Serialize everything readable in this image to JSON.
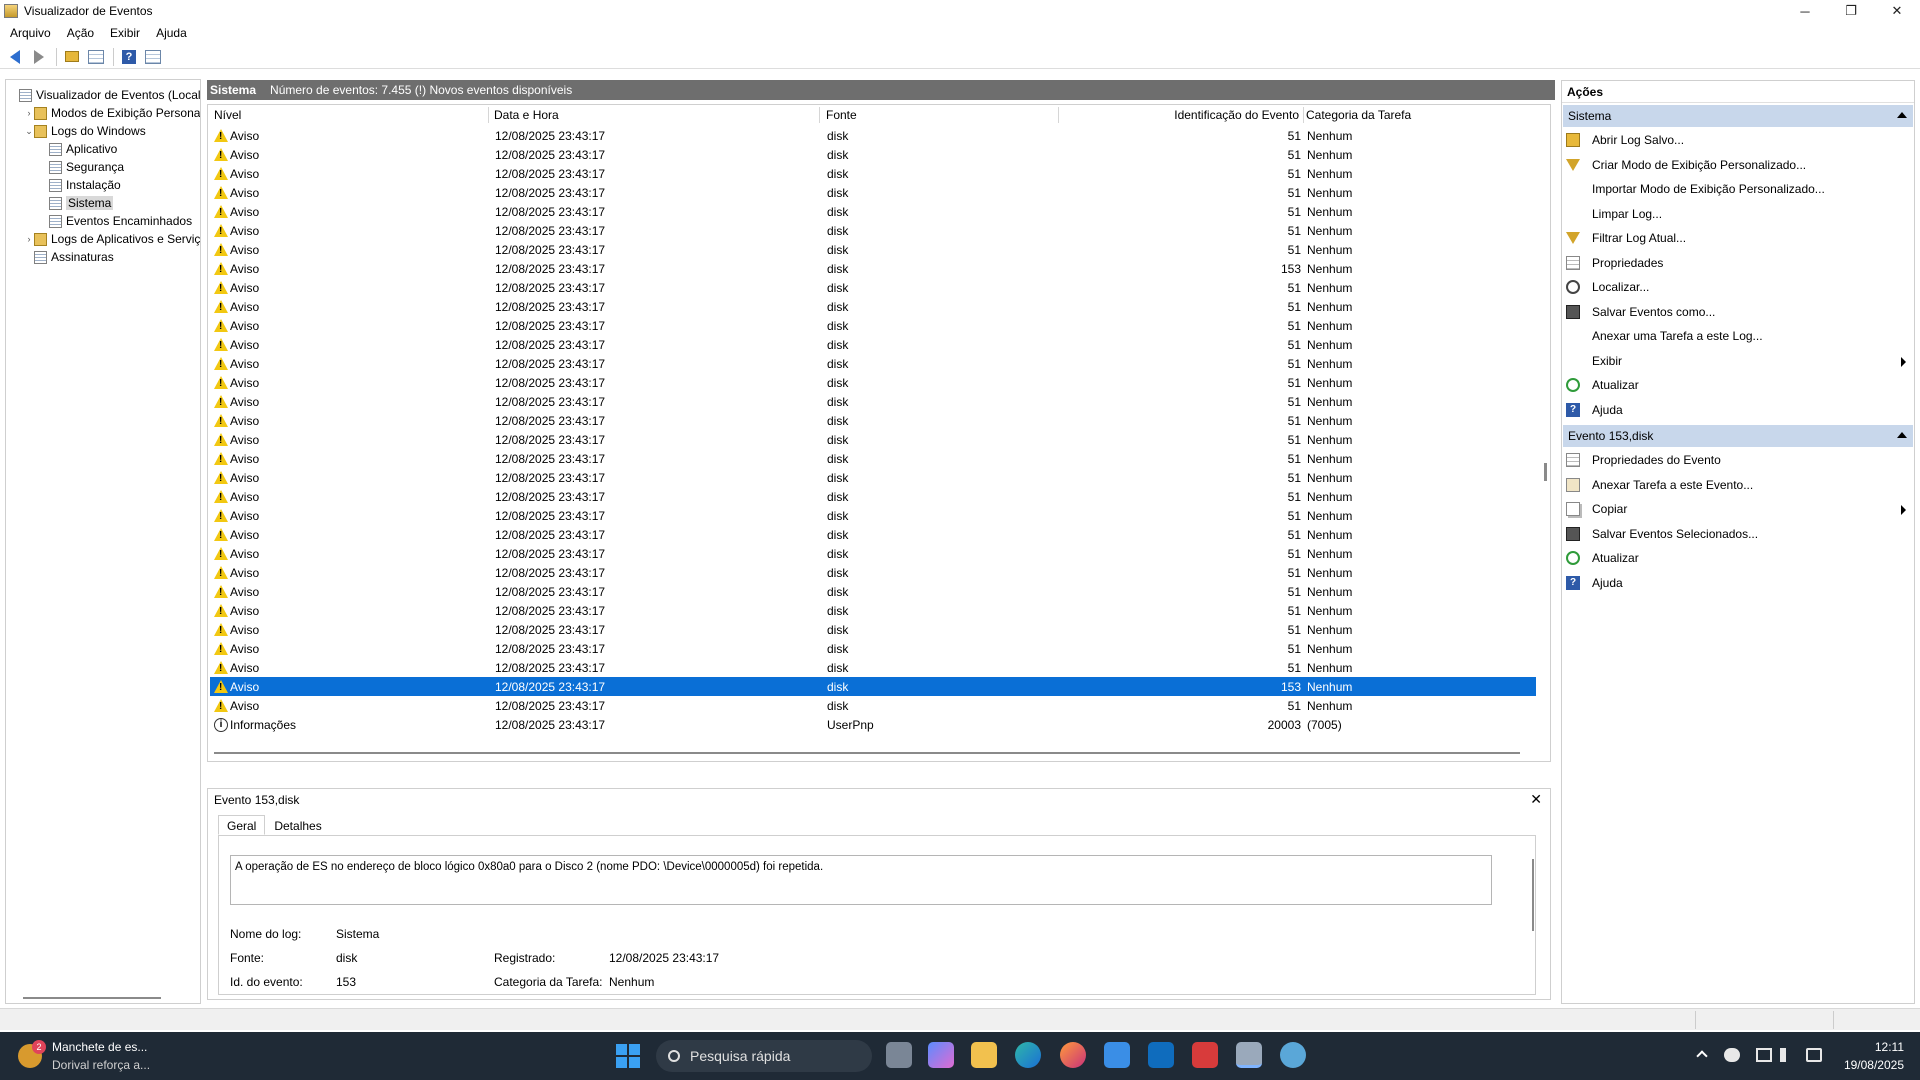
{
  "window": {
    "title": "Visualizador de Eventos",
    "controls": [
      "─",
      "❐",
      "✕"
    ]
  },
  "menu": [
    "Arquivo",
    "Ação",
    "Exibir",
    "Ajuda"
  ],
  "tree": [
    {
      "label": "Visualizador de Eventos (Local)",
      "level": 0,
      "twisty": "",
      "icon": "log"
    },
    {
      "label": "Modos de Exibição Personali",
      "level": 1,
      "twisty": "›",
      "icon": "folder"
    },
    {
      "label": "Logs do Windows",
      "level": 1,
      "twisty": "⌄",
      "icon": "folder"
    },
    {
      "label": "Aplicativo",
      "level": 2,
      "twisty": "",
      "icon": "log"
    },
    {
      "label": "Segurança",
      "level": 2,
      "twisty": "",
      "icon": "log"
    },
    {
      "label": "Instalação",
      "level": 2,
      "twisty": "",
      "icon": "log"
    },
    {
      "label": "Sistema",
      "level": 2,
      "twisty": "",
      "icon": "log",
      "selected": true
    },
    {
      "label": "Eventos Encaminhados",
      "level": 2,
      "twisty": "",
      "icon": "log"
    },
    {
      "label": "Logs de Aplicativos e Serviço",
      "level": 1,
      "twisty": "›",
      "icon": "folder"
    },
    {
      "label": "Assinaturas",
      "level": 1,
      "twisty": "",
      "icon": "log"
    }
  ],
  "center": {
    "log_name": "Sistema",
    "summary": "Número de eventos: 7.455 (!) Novos eventos disponíveis",
    "columns": [
      "Nível",
      "Data e Hora",
      "Fonte",
      "Identificação do Evento",
      "Categoria da Tarefa"
    ],
    "rows": [
      {
        "level": "Aviso",
        "icon": "warning",
        "date": "12/08/2025 23:43:17",
        "source": "disk",
        "id": "51",
        "category": "Nenhum"
      },
      {
        "level": "Aviso",
        "icon": "warning",
        "date": "12/08/2025 23:43:17",
        "source": "disk",
        "id": "51",
        "category": "Nenhum"
      },
      {
        "level": "Aviso",
        "icon": "warning",
        "date": "12/08/2025 23:43:17",
        "source": "disk",
        "id": "51",
        "category": "Nenhum"
      },
      {
        "level": "Aviso",
        "icon": "warning",
        "date": "12/08/2025 23:43:17",
        "source": "disk",
        "id": "51",
        "category": "Nenhum"
      },
      {
        "level": "Aviso",
        "icon": "warning",
        "date": "12/08/2025 23:43:17",
        "source": "disk",
        "id": "51",
        "category": "Nenhum"
      },
      {
        "level": "Aviso",
        "icon": "warning",
        "date": "12/08/2025 23:43:17",
        "source": "disk",
        "id": "51",
        "category": "Nenhum"
      },
      {
        "level": "Aviso",
        "icon": "warning",
        "date": "12/08/2025 23:43:17",
        "source": "disk",
        "id": "51",
        "category": "Nenhum"
      },
      {
        "level": "Aviso",
        "icon": "warning",
        "date": "12/08/2025 23:43:17",
        "source": "disk",
        "id": "153",
        "category": "Nenhum"
      },
      {
        "level": "Aviso",
        "icon": "warning",
        "date": "12/08/2025 23:43:17",
        "source": "disk",
        "id": "51",
        "category": "Nenhum"
      },
      {
        "level": "Aviso",
        "icon": "warning",
        "date": "12/08/2025 23:43:17",
        "source": "disk",
        "id": "51",
        "category": "Nenhum"
      },
      {
        "level": "Aviso",
        "icon": "warning",
        "date": "12/08/2025 23:43:17",
        "source": "disk",
        "id": "51",
        "category": "Nenhum"
      },
      {
        "level": "Aviso",
        "icon": "warning",
        "date": "12/08/2025 23:43:17",
        "source": "disk",
        "id": "51",
        "category": "Nenhum"
      },
      {
        "level": "Aviso",
        "icon": "warning",
        "date": "12/08/2025 23:43:17",
        "source": "disk",
        "id": "51",
        "category": "Nenhum"
      },
      {
        "level": "Aviso",
        "icon": "warning",
        "date": "12/08/2025 23:43:17",
        "source": "disk",
        "id": "51",
        "category": "Nenhum"
      },
      {
        "level": "Aviso",
        "icon": "warning",
        "date": "12/08/2025 23:43:17",
        "source": "disk",
        "id": "51",
        "category": "Nenhum"
      },
      {
        "level": "Aviso",
        "icon": "warning",
        "date": "12/08/2025 23:43:17",
        "source": "disk",
        "id": "51",
        "category": "Nenhum"
      },
      {
        "level": "Aviso",
        "icon": "warning",
        "date": "12/08/2025 23:43:17",
        "source": "disk",
        "id": "51",
        "category": "Nenhum"
      },
      {
        "level": "Aviso",
        "icon": "warning",
        "date": "12/08/2025 23:43:17",
        "source": "disk",
        "id": "51",
        "category": "Nenhum"
      },
      {
        "level": "Aviso",
        "icon": "warning",
        "date": "12/08/2025 23:43:17",
        "source": "disk",
        "id": "51",
        "category": "Nenhum"
      },
      {
        "level": "Aviso",
        "icon": "warning",
        "date": "12/08/2025 23:43:17",
        "source": "disk",
        "id": "51",
        "category": "Nenhum"
      },
      {
        "level": "Aviso",
        "icon": "warning",
        "date": "12/08/2025 23:43:17",
        "source": "disk",
        "id": "51",
        "category": "Nenhum"
      },
      {
        "level": "Aviso",
        "icon": "warning",
        "date": "12/08/2025 23:43:17",
        "source": "disk",
        "id": "51",
        "category": "Nenhum"
      },
      {
        "level": "Aviso",
        "icon": "warning",
        "date": "12/08/2025 23:43:17",
        "source": "disk",
        "id": "51",
        "category": "Nenhum"
      },
      {
        "level": "Aviso",
        "icon": "warning",
        "date": "12/08/2025 23:43:17",
        "source": "disk",
        "id": "51",
        "category": "Nenhum"
      },
      {
        "level": "Aviso",
        "icon": "warning",
        "date": "12/08/2025 23:43:17",
        "source": "disk",
        "id": "51",
        "category": "Nenhum"
      },
      {
        "level": "Aviso",
        "icon": "warning",
        "date": "12/08/2025 23:43:17",
        "source": "disk",
        "id": "51",
        "category": "Nenhum"
      },
      {
        "level": "Aviso",
        "icon": "warning",
        "date": "12/08/2025 23:43:17",
        "source": "disk",
        "id": "51",
        "category": "Nenhum"
      },
      {
        "level": "Aviso",
        "icon": "warning",
        "date": "12/08/2025 23:43:17",
        "source": "disk",
        "id": "51",
        "category": "Nenhum"
      },
      {
        "level": "Aviso",
        "icon": "warning",
        "date": "12/08/2025 23:43:17",
        "source": "disk",
        "id": "51",
        "category": "Nenhum"
      },
      {
        "level": "Aviso",
        "icon": "warning",
        "date": "12/08/2025 23:43:17",
        "source": "disk",
        "id": "153",
        "category": "Nenhum",
        "selected": true
      },
      {
        "level": "Aviso",
        "icon": "warning",
        "date": "12/08/2025 23:43:17",
        "source": "disk",
        "id": "51",
        "category": "Nenhum"
      },
      {
        "level": "Informações",
        "icon": "info",
        "date": "12/08/2025 23:43:17",
        "source": "UserPnp",
        "id": "20003",
        "category": "(7005)"
      }
    ],
    "selected_color": "#0a6fd6"
  },
  "details": {
    "title": "Evento 153,disk",
    "close": "✕",
    "tabs": [
      "Geral",
      "Detalhes"
    ],
    "message": "A operação de ES no endereço de bloco lógico 0x80a0 para o Disco 2 (nome PDO: \\Device\\0000005d) foi repetida.",
    "log_name_label": "Nome do log:",
    "log_name_value": "Sistema",
    "source_label": "Fonte:",
    "source_value": "disk",
    "recorded_label": "Registrado:",
    "recorded_value": "12/08/2025 23:43:17",
    "event_id_label": "Id. do evento:",
    "event_id_value": "153",
    "task_label": "Categoria da Tarefa:",
    "task_value": "Nenhum"
  },
  "actions": {
    "title": "Ações",
    "section1": "Sistema",
    "items1": [
      {
        "label": "Abrir Log Salvo...",
        "icon": "open"
      },
      {
        "label": "Criar Modo de Exibição Personalizado...",
        "icon": "funnel"
      },
      {
        "label": "Importar Modo de Exibição Personalizado...",
        "icon": "blank"
      },
      {
        "label": "Limpar Log...",
        "icon": "blank"
      },
      {
        "label": "Filtrar Log Atual...",
        "icon": "funnel"
      },
      {
        "label": "Propriedades",
        "icon": "props"
      },
      {
        "label": "Localizar...",
        "icon": "find"
      },
      {
        "label": "Salvar Eventos como...",
        "icon": "save"
      },
      {
        "label": "Anexar uma Tarefa a este Log...",
        "icon": "blank"
      },
      {
        "label": "Exibir",
        "icon": "blank",
        "submenu": true
      },
      {
        "label": "Atualizar",
        "icon": "refresh"
      },
      {
        "label": "Ajuda",
        "icon": "help"
      }
    ],
    "section2": "Evento 153,disk",
    "items2": [
      {
        "label": "Propriedades do Evento",
        "icon": "props"
      },
      {
        "label": "Anexar Tarefa a este Evento...",
        "icon": "attach"
      },
      {
        "label": "Copiar",
        "icon": "copy",
        "submenu": true
      },
      {
        "label": "Salvar Eventos Selecionados...",
        "icon": "save"
      },
      {
        "label": "Atualizar",
        "icon": "refresh"
      },
      {
        "label": "Ajuda",
        "icon": "help"
      }
    ]
  },
  "taskbar": {
    "news_badge": "2",
    "news_title": "Manchete de es...",
    "news_subtitle": "Dorival reforça a...",
    "search_placeholder": "Pesquisa rápida",
    "time": "12:11",
    "date": "19/08/2025"
  }
}
